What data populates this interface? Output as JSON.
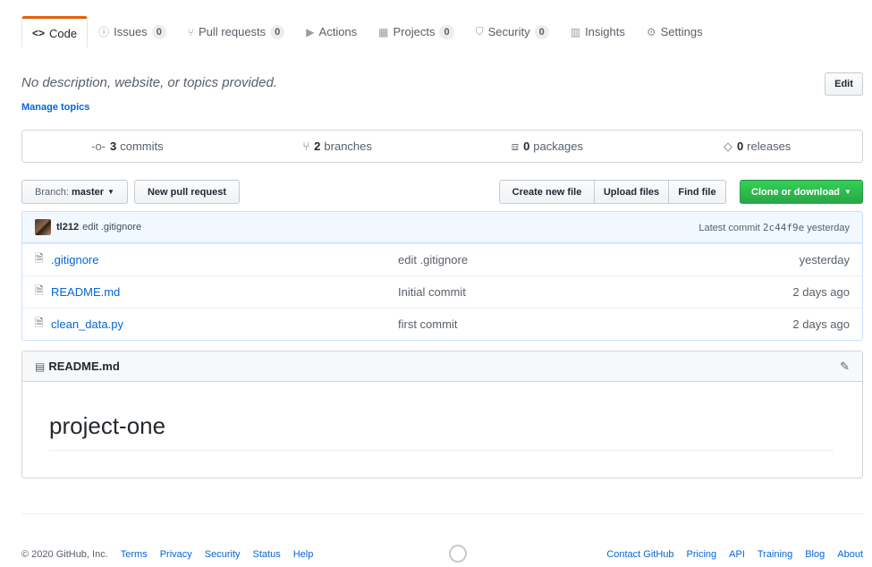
{
  "tabs": [
    {
      "icon": "code-icon",
      "glyph": "<>",
      "label": "Code",
      "count": null,
      "selected": true
    },
    {
      "icon": "issue-icon",
      "glyph": "ⓘ",
      "label": "Issues",
      "count": "0",
      "selected": false
    },
    {
      "icon": "pull-request-icon",
      "glyph": "⑂",
      "label": "Pull requests",
      "count": "0",
      "selected": false
    },
    {
      "icon": "play-icon",
      "glyph": "▶",
      "label": "Actions",
      "count": null,
      "selected": false
    },
    {
      "icon": "project-icon",
      "glyph": "▦",
      "label": "Projects",
      "count": "0",
      "selected": false
    },
    {
      "icon": "shield-icon",
      "glyph": "⛉",
      "label": "Security",
      "count": "0",
      "selected": false
    },
    {
      "icon": "graph-icon",
      "glyph": "▥",
      "label": "Insights",
      "count": null,
      "selected": false
    },
    {
      "icon": "gear-icon",
      "glyph": "⚙",
      "label": "Settings",
      "count": null,
      "selected": false
    }
  ],
  "description": {
    "text": "No description, website, or topics provided.",
    "manage_topics": "Manage topics",
    "edit_label": "Edit"
  },
  "summary": {
    "commits": {
      "count": "3",
      "label": "commits"
    },
    "branches": {
      "count": "2",
      "label": "branches"
    },
    "packages": {
      "count": "0",
      "label": "packages"
    },
    "releases": {
      "count": "0",
      "label": "releases"
    }
  },
  "file_nav": {
    "branch_prefix": "Branch:",
    "branch_name": "master",
    "new_pr": "New pull request",
    "create_file": "Create new file",
    "upload_files": "Upload files",
    "find_file": "Find file",
    "clone": "Clone or download"
  },
  "latest_commit": {
    "author": "tl212",
    "message": "edit .gitignore",
    "label": "Latest commit",
    "sha": "2c44f9e",
    "age": "yesterday"
  },
  "files": [
    {
      "name": ".gitignore",
      "message": "edit .gitignore",
      "age": "yesterday"
    },
    {
      "name": "README.md",
      "message": "Initial commit",
      "age": "2 days ago"
    },
    {
      "name": "clean_data.py",
      "message": "first commit",
      "age": "2 days ago"
    }
  ],
  "readme": {
    "filename": "README.md",
    "title": "project-one"
  },
  "footer": {
    "copyright": "© 2020 GitHub, Inc.",
    "left_links": [
      "Terms",
      "Privacy",
      "Security",
      "Status",
      "Help"
    ],
    "right_links": [
      "Contact GitHub",
      "Pricing",
      "API",
      "Training",
      "Blog",
      "About"
    ]
  },
  "colors": {
    "accent_tab": "#e36209",
    "link": "#0366d6",
    "clone_button": "#28a745",
    "commit_bar": "#f1f8ff"
  }
}
